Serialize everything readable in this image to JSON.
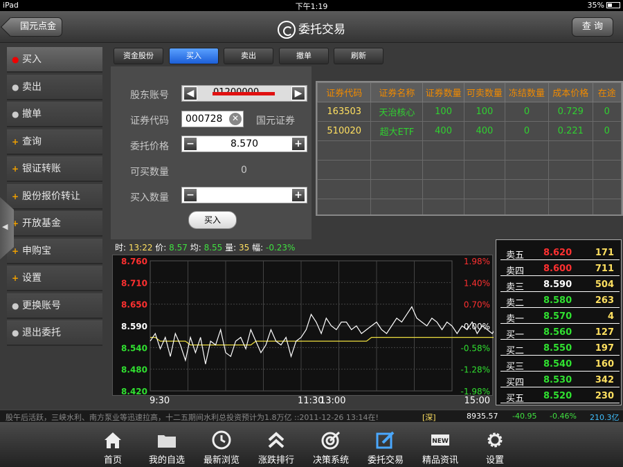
{
  "status_bar": {
    "device": "iPad",
    "time": "下午1:19",
    "battery": "35%"
  },
  "nav": {
    "back_label": "国元点金",
    "title": "委托交易",
    "query_label": "查 询"
  },
  "menu": [
    {
      "label": "买入",
      "marker": "●",
      "active": true
    },
    {
      "label": "卖出",
      "marker": "●"
    },
    {
      "label": "撤单",
      "marker": "●"
    },
    {
      "label": "查询",
      "marker": "+"
    },
    {
      "label": "银证转账",
      "marker": "+"
    },
    {
      "label": "股份报价转让",
      "marker": "+"
    },
    {
      "label": "开放基金",
      "marker": "+"
    },
    {
      "label": "申购宝",
      "marker": "+"
    },
    {
      "label": "设置",
      "marker": "+"
    },
    {
      "label": "更换账号",
      "marker": "●"
    },
    {
      "label": "退出委托",
      "marker": "●"
    }
  ],
  "tabs": [
    "资金股份",
    "买入",
    "卖出",
    "撤单",
    "刷新"
  ],
  "form": {
    "account_label": "股东账号",
    "account_value": "01200000",
    "code_label": "证券代码",
    "code_value": "000728",
    "code_name": "国元证券",
    "price_label": "委托价格",
    "price_value": "8.570",
    "buyable_label": "可买数量",
    "buyable_value": "0",
    "qty_label": "买入数量",
    "qty_value": "",
    "submit_label": "买入"
  },
  "holdings": {
    "columns": [
      "证券代码",
      "证券名称",
      "证券数量",
      "可卖数量",
      "冻结数量",
      "成本价格",
      "在途"
    ],
    "rows": [
      [
        "163503",
        "天治核心",
        "100",
        "100",
        "0",
        "0.729",
        "0"
      ],
      [
        "510020",
        "超大ETF",
        "400",
        "400",
        "0",
        "0.221",
        "0"
      ]
    ]
  },
  "quote": {
    "time_label": "时:",
    "time": "13:22",
    "price_label": "价:",
    "price": "8.57",
    "avg_label": "均:",
    "avg": "8.55",
    "vol_label": "量:",
    "vol": "35",
    "pct_label": "幅:",
    "pct": "-0.23%"
  },
  "chart_data": {
    "type": "line",
    "y_ticks_left": [
      "8.760",
      "8.710",
      "8.650",
      "8.590",
      "8.540",
      "8.480",
      "8.420"
    ],
    "y_ticks_right": [
      "1.98%",
      "1.40%",
      "0.70%",
      "0.00%",
      "-0.58%",
      "-1.28%",
      "-1.98%"
    ],
    "x_ticks": [
      "9:30",
      "11:30",
      "13:00",
      "15:00"
    ],
    "ylim": [
      8.42,
      8.76
    ],
    "prev_close": 8.59,
    "series": [
      {
        "values": [
          8.55,
          8.57,
          8.53,
          8.56,
          8.51,
          8.57,
          8.54,
          8.5,
          8.56,
          8.52,
          8.56,
          8.49,
          8.55,
          8.54,
          8.58,
          8.52,
          8.51,
          8.55,
          8.56,
          8.53,
          8.58,
          8.55,
          8.52,
          8.54,
          8.58,
          8.55,
          8.54,
          8.56,
          8.51,
          8.55,
          8.56,
          8.58,
          8.62,
          8.6,
          8.57,
          8.61,
          8.59,
          8.58,
          8.6,
          8.6,
          8.58,
          8.59,
          8.57,
          8.58,
          8.59,
          8.6,
          8.58,
          8.57,
          8.59,
          8.61,
          8.6,
          8.62,
          8.64,
          8.61,
          8.6,
          8.59,
          8.61,
          8.6,
          8.58,
          8.6,
          8.59,
          8.57,
          8.59,
          8.58,
          8.6,
          8.57,
          8.59,
          8.58,
          8.57,
          8.59,
          8.58,
          8.58,
          8.57,
          8.58,
          8.58
        ]
      },
      {
        "values": [
          8.56,
          8.56,
          8.55,
          8.55,
          8.55,
          8.55,
          8.55,
          8.55,
          8.54,
          8.54,
          8.54,
          8.54,
          8.54,
          8.54,
          8.54,
          8.54,
          8.54,
          8.54,
          8.54,
          8.54,
          8.54,
          8.55,
          8.55,
          8.55,
          8.55,
          8.55,
          8.55,
          8.55,
          8.55,
          8.55,
          8.55,
          8.55,
          8.55,
          8.55,
          8.55,
          8.55,
          8.55,
          8.55,
          8.55,
          8.55,
          8.55,
          8.55,
          8.55,
          8.55,
          8.56,
          8.56,
          8.56,
          8.56,
          8.56,
          8.56,
          8.56,
          8.56,
          8.56,
          8.56,
          8.56,
          8.56,
          8.56,
          8.56,
          8.56,
          8.56,
          8.56,
          8.56,
          8.56,
          8.56,
          8.56,
          8.56,
          8.56,
          8.56,
          8.56,
          8.56,
          8.56,
          8.56,
          8.56,
          8.56,
          8.56
        ]
      }
    ],
    "colors": {
      "price": "#ffffff",
      "avg": "#f0e040",
      "up": "#ff3030",
      "down": "#30e030",
      "flat": "#ffffff"
    }
  },
  "order_book": [
    {
      "label": "卖五",
      "price": "8.620",
      "vol": "171",
      "side": "up"
    },
    {
      "label": "卖四",
      "price": "8.600",
      "vol": "711",
      "side": "up"
    },
    {
      "label": "卖三",
      "price": "8.590",
      "vol": "504",
      "side": "flat"
    },
    {
      "label": "卖二",
      "price": "8.580",
      "vol": "263",
      "side": "down"
    },
    {
      "label": "卖一",
      "price": "8.570",
      "vol": "4",
      "side": "down"
    },
    {
      "label": "买一",
      "price": "8.560",
      "vol": "127",
      "side": "down"
    },
    {
      "label": "买二",
      "price": "8.550",
      "vol": "197",
      "side": "down"
    },
    {
      "label": "买三",
      "price": "8.540",
      "vol": "160",
      "side": "down"
    },
    {
      "label": "买四",
      "price": "8.530",
      "vol": "342",
      "side": "down"
    },
    {
      "label": "买五",
      "price": "8.520",
      "vol": "230",
      "side": "down"
    }
  ],
  "ticker": {
    "message": "股午后活跃，三峡水利、南方泵业等迅速拉高，十二五期间水利总投资预计为1.8万亿 ::2011-12-26 13:14在!",
    "market": "[深]",
    "index": "8935.57",
    "change": "-40.95",
    "pct": "-0.46%",
    "amount": "210.3亿"
  },
  "tabbar": [
    {
      "label": "首页",
      "icon": "home-icon"
    },
    {
      "label": "我的自选",
      "icon": "folder-icon"
    },
    {
      "label": "最新浏览",
      "icon": "clock-icon"
    },
    {
      "label": "涨跌排行",
      "icon": "chevrons-up-icon"
    },
    {
      "label": "决策系统",
      "icon": "target-icon"
    },
    {
      "label": "委托交易",
      "icon": "edit-icon"
    },
    {
      "label": "精品资讯",
      "icon": "new-badge-icon"
    },
    {
      "label": "设置",
      "icon": "gear-icon"
    }
  ]
}
